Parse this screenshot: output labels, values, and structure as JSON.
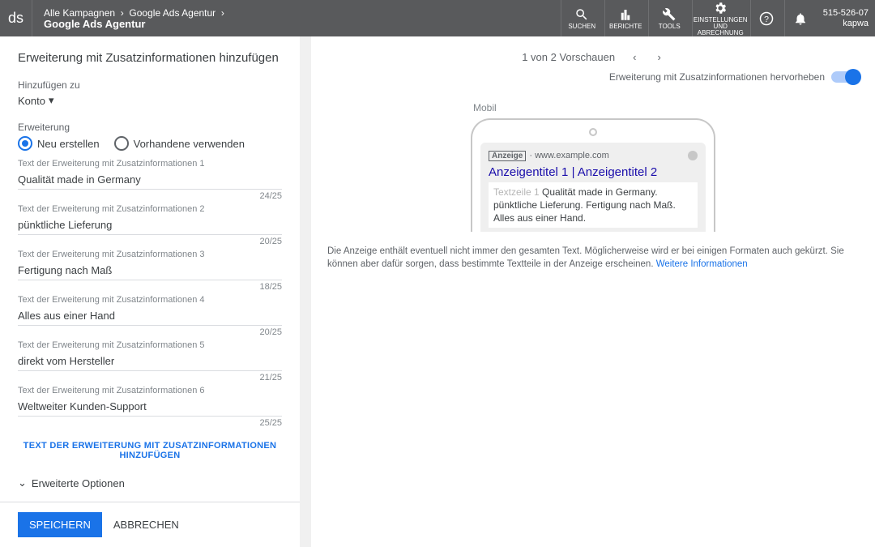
{
  "header": {
    "logo": "ds",
    "crumb1": "Alle Kampagnen",
    "crumb2": "Google Ads Agentur",
    "crumb3": "Google Ads Agentur",
    "icons": {
      "search": "SUCHEN",
      "reports": "BERICHTE",
      "tools": "TOOLS",
      "settings": "EINSTELLUNGEN UND ABRECHNUNG"
    },
    "acct1": "515-526-07",
    "acct2": "kapwa"
  },
  "left": {
    "title": "Erweiterung mit Zusatzinformationen hinzufügen",
    "addTo": "Hinzufügen zu",
    "konto": "Konto",
    "ext": "Erweiterung",
    "radioNew": "Neu erstellen",
    "radioExisting": "Vorhandene verwenden",
    "fields": [
      {
        "label": "Text der Erweiterung mit Zusatzinformationen 1",
        "value": "Qualität made in Germany",
        "count": "24/25"
      },
      {
        "label": "Text der Erweiterung mit Zusatzinformationen 2",
        "value": "pünktliche Lieferung",
        "count": "20/25"
      },
      {
        "label": "Text der Erweiterung mit Zusatzinformationen 3",
        "value": "Fertigung nach Maß",
        "count": "18/25"
      },
      {
        "label": "Text der Erweiterung mit Zusatzinformationen 4",
        "value": "Alles aus einer Hand",
        "count": "20/25"
      },
      {
        "label": "Text der Erweiterung mit Zusatzinformationen 5",
        "value": "direkt vom Hersteller",
        "count": "21/25"
      },
      {
        "label": "Text der Erweiterung mit Zusatzinformationen 6",
        "value": "Weltweiter Kunden-Support",
        "count": "25/25"
      }
    ],
    "addLink": "TEXT DER ERWEITERUNG MIT ZUSATZINFORMATIONEN HINZUFÜGEN",
    "advanced": "Erweiterte Optionen",
    "save": "SPEICHERN",
    "cancel": "ABBRECHEN"
  },
  "right": {
    "prevLabel": "1 von 2 Vorschauen",
    "highlight": "Erweiterung mit Zusatzinformationen hervorheben",
    "mobil": "Mobil",
    "adBadge": "Anzeige",
    "adUrl": "www.example.com",
    "adTitle": "Anzeigentitel 1 | Anzeigentitel 2",
    "adTz": "Textzeile 1",
    "adBody": " Qualität made in Germany. pünktliche Lieferung. Fertigung nach Maß. Alles aus einer Hand.",
    "note": "Die Anzeige enthält eventuell nicht immer den gesamten Text. Möglicherweise wird er bei einigen Formaten auch gekürzt. Sie können aber dafür sorgen, dass bestimmte Textteile in der Anzeige erscheinen. ",
    "noteLink": "Weitere Informationen"
  }
}
